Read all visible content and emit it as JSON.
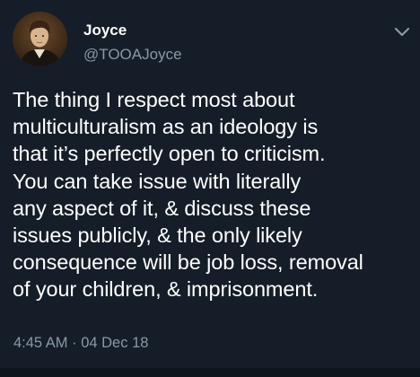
{
  "author": {
    "display_name": "Joyce",
    "handle": "@TOOAJoyce"
  },
  "tweet": {
    "lines": [
      "The thing I respect most about",
      "multiculturalism as an ideology is",
      "that it’s perfectly open to criticism.",
      "You can take issue with literally",
      "any aspect of it, & discuss these",
      "issues publicly, & the only likely",
      "consequence will be job loss, removal",
      "of your children, & imprisonment."
    ],
    "timestamp": "4:45 AM · 04 Dec 18"
  },
  "icons": {
    "menu": "chevron-down-icon",
    "avatar": "portrait-avatar"
  },
  "colors": {
    "background": "#151d28",
    "primary_text": "#ffffff",
    "secondary_text": "#8899a6"
  }
}
